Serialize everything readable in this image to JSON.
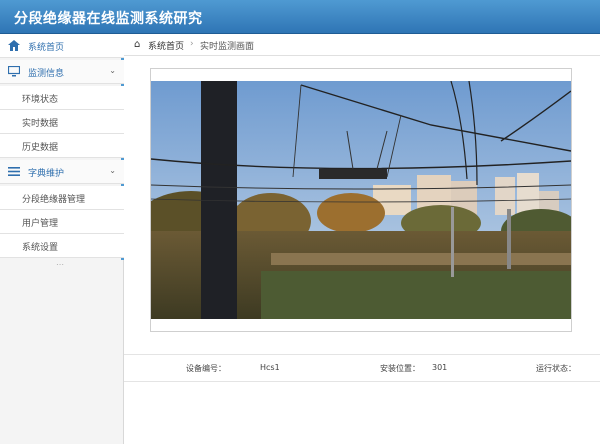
{
  "header": {
    "title": "分段绝缘器在线监测系统研究"
  },
  "sidebar": {
    "items": [
      {
        "label": "系统首页",
        "icon": "home-icon",
        "type": "top",
        "active": true
      },
      {
        "label": "监测信息",
        "icon": "monitor-icon",
        "type": "group",
        "chevron": "expanded"
      },
      {
        "label": "环境状态",
        "type": "sub"
      },
      {
        "label": "实时数据",
        "type": "sub"
      },
      {
        "label": "历史数据",
        "type": "sub"
      },
      {
        "label": "字典维护",
        "icon": "list-icon",
        "type": "group",
        "chevron": "expanded"
      },
      {
        "label": "分段绝缘器管理",
        "type": "sub"
      },
      {
        "label": "用户管理",
        "type": "sub"
      },
      {
        "label": "系统设置",
        "type": "sub"
      }
    ]
  },
  "breadcrumb": {
    "home": "系统首页",
    "current": "实时监测画面"
  },
  "info": {
    "device_label": "设备编号：",
    "device_value": "Hcs1",
    "location_label": "安装位置：",
    "location_value": "301",
    "status_label": "运行状态："
  },
  "colors": {
    "header": "#3a83c3",
    "accent": "#2f6fae",
    "sky": "#8fb3d9"
  }
}
